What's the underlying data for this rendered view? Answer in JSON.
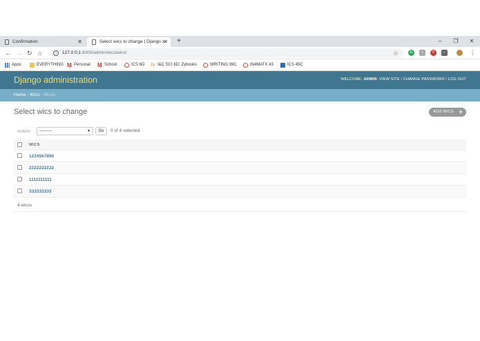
{
  "browser": {
    "tabs": [
      {
        "title": "Confirmation",
        "active": false
      },
      {
        "title": "Select wics to change | Django s",
        "active": true
      }
    ],
    "url_host": "127.0.0.1",
    "url_rest": ":8000/admin/wics/wics/",
    "bookmarks": [
      "Apps",
      "EVERYTHING",
      "Personal",
      "School",
      "ICS 6D",
      "I&C SCI 6D: Zybooks",
      "WRITING 39C",
      "IN4MATX 43",
      "ICS 45C"
    ]
  },
  "header": {
    "brand": "Django administration",
    "welcome": "WELCOME,",
    "user": "ADMIN",
    "view_site": "VIEW SITE",
    "change_password": "CHANGE PASSWORD",
    "log_out": "LOG OUT"
  },
  "breadcrumbs": {
    "home": "Home",
    "app": "Wics",
    "current": "Wicss"
  },
  "page": {
    "title": "Select wics to change",
    "add_button": "ADD WICS"
  },
  "actions": {
    "label": "Action:",
    "selected_option": "---------",
    "go_label": "Go",
    "selection_count": "0 of 4 selected"
  },
  "table": {
    "column": "WICS",
    "rows": [
      "1234567890",
      "2222222222",
      "1111111111",
      "333333333"
    ]
  },
  "paginator": "4 wicss",
  "colors": {
    "header_bg": "#417690",
    "brand": "#f5dd5d",
    "breadcrumb_bg": "#79aec8",
    "link": "#447e9b"
  }
}
